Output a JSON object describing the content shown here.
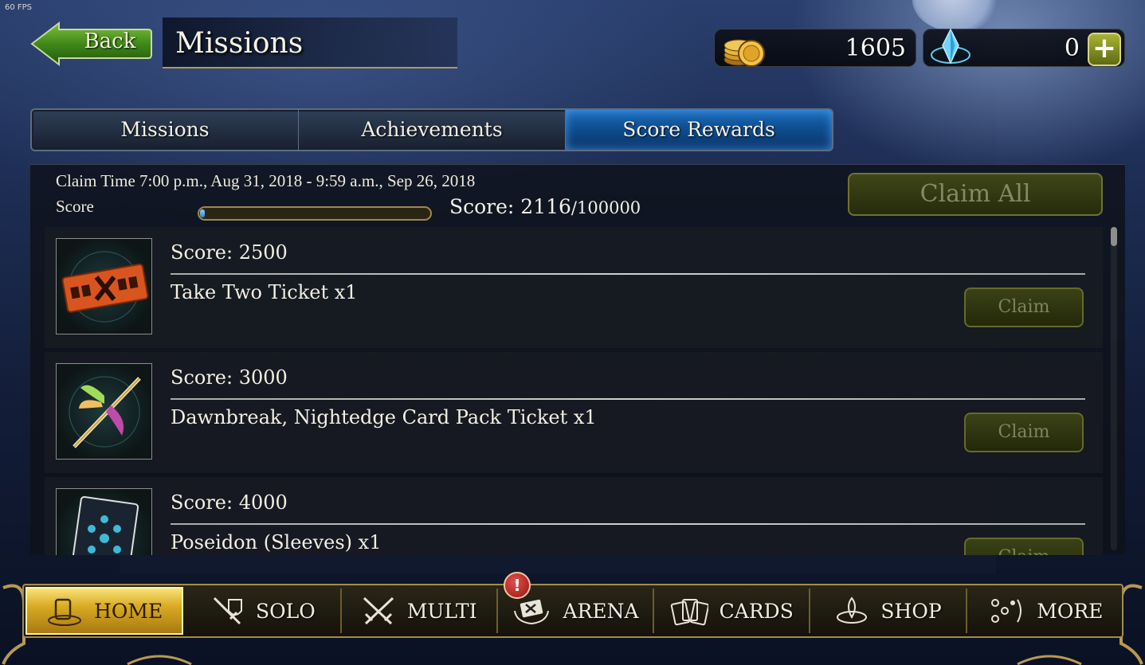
{
  "fps": "60 FPS",
  "header": {
    "back_label": "Back",
    "title": "Missions",
    "gold": "1605",
    "crystals": "0",
    "plus": "+"
  },
  "tabs": [
    {
      "label": "Missions",
      "active": false
    },
    {
      "label": "Achievements",
      "active": false
    },
    {
      "label": "Score Rewards",
      "active": true
    }
  ],
  "panel": {
    "claim_time": "Claim Time 7:00 p.m., Aug 31, 2018 - 9:59 a.m., Sep 26, 2018",
    "score_label": "Score",
    "score_prefix": "Score: 2116",
    "score_max": "/100000",
    "score_value": 2116,
    "score_total": 100000,
    "claim_all": "Claim All"
  },
  "rewards": [
    {
      "score": "Score: 2500",
      "name": "Take Two Ticket x1",
      "claim": "Claim",
      "icon": "ticket-icon"
    },
    {
      "score": "Score: 3000",
      "name": "Dawnbreak, Nightedge Card Pack Ticket x1",
      "claim": "Claim",
      "icon": "sword-icon"
    },
    {
      "score": "Score: 4000",
      "name": "Poseidon (Sleeves) x1",
      "claim": "Claim",
      "icon": "sleeve-icon"
    }
  ],
  "nav": [
    {
      "label": "HOME",
      "icon": "home-icon",
      "active": true
    },
    {
      "label": "SOLO",
      "icon": "solo-icon",
      "active": false
    },
    {
      "label": "MULTI",
      "icon": "multi-icon",
      "active": false
    },
    {
      "label": "ARENA",
      "icon": "arena-icon",
      "active": false
    },
    {
      "label": "CARDS",
      "icon": "cards-icon",
      "active": false
    },
    {
      "label": "SHOP",
      "icon": "shop-icon",
      "active": false
    },
    {
      "label": "MORE",
      "icon": "more-icon",
      "active": false
    }
  ],
  "badge": "!",
  "colors": {
    "tab_active": "#0e4f93",
    "nav_active": "#d9aa22",
    "claim_disabled": "#3b4217",
    "progress_fill": "#2c84d1"
  }
}
